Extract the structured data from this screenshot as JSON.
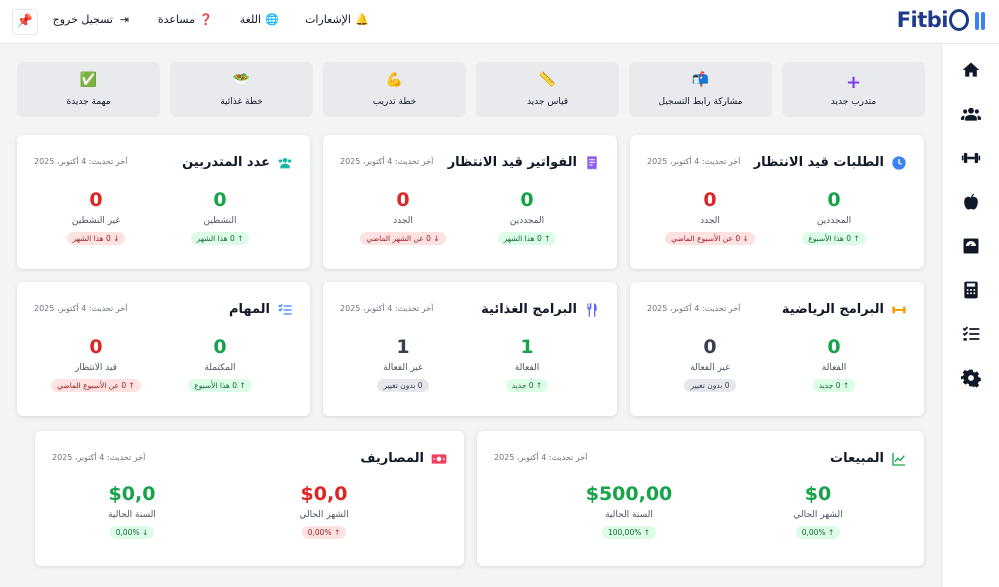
{
  "brand": {
    "logo_text": "Fitbi"
  },
  "topbar": {
    "notifications": "الإشعارات",
    "language": "اللغة",
    "help": "مساعدة",
    "logout": "تسجيل خروج"
  },
  "sidebar": {
    "items": [
      "home-icon",
      "users-icon",
      "dumbbell-icon",
      "apple-icon",
      "scale-icon",
      "calculator-icon",
      "checklist-icon",
      "gear-icon"
    ]
  },
  "quick_actions": [
    {
      "label": "متدرب جديد",
      "icon": "plus-icon"
    },
    {
      "label": "مشاركة رابط التسجيل",
      "icon": "mailbox-icon"
    },
    {
      "label": "قياس جديد",
      "icon": "ruler-icon"
    },
    {
      "label": "خطة تدريب",
      "icon": "flexed-biceps-icon"
    },
    {
      "label": "خطة غذائية",
      "icon": "salad-icon"
    },
    {
      "label": "مهمة جديدة",
      "icon": "check-box-icon"
    }
  ],
  "cards": {
    "pending_requests": {
      "title": "الطلبات قيد الانتظار",
      "updated": "آخر تحديث: 4 أكتوبر، 2025",
      "stat1": {
        "value": "0",
        "label": "المجددين",
        "badge": "0 هذا الأسبوع"
      },
      "stat2": {
        "value": "0",
        "label": "الجدد",
        "badge": "0 عن الأسبوع الماضي"
      }
    },
    "pending_invoices": {
      "title": "الفواتير قيد الانتظار",
      "updated": "آخر تحديث: 4 أكتوبر، 2025",
      "stat1": {
        "value": "0",
        "label": "المجددين",
        "badge": "0 هذا الشهر"
      },
      "stat2": {
        "value": "0",
        "label": "الجدد",
        "badge": "0 عن الشهر الماضي"
      }
    },
    "trainees": {
      "title": "عدد المتدربين",
      "updated": "آخر تحديث: 4 أكتوبر، 2025",
      "stat1": {
        "value": "0",
        "label": "النشطين",
        "badge": "0 هذا الشهر"
      },
      "stat2": {
        "value": "0",
        "label": "غير النشطين",
        "badge": "0 هذا الشهر"
      }
    },
    "workout_programs": {
      "title": "البرامج الرياضية",
      "updated": "آخر تحديث: 4 أكتوبر، 2025",
      "stat1": {
        "value": "0",
        "label": "الفعالة",
        "badge": "0 جديد"
      },
      "stat2": {
        "value": "0",
        "label": "غير الفعالة",
        "badge": "0 بدون تغيير"
      }
    },
    "diet_programs": {
      "title": "البرامج الغذائية",
      "updated": "آخر تحديث: 4 أكتوبر، 2025",
      "stat1": {
        "value": "1",
        "label": "الفعالة",
        "badge": "0 جديد"
      },
      "stat2": {
        "value": "1",
        "label": "غير الفعالة",
        "badge": "0 بدون تغيير"
      }
    },
    "tasks": {
      "title": "المهام",
      "updated": "آخر تحديث: 4 أكتوبر، 2025",
      "stat1": {
        "value": "0",
        "label": "المكتملة",
        "badge": "0 هذا الأسبوع"
      },
      "stat2": {
        "value": "0",
        "label": "قيد الانتظار",
        "badge": "0 عن الأسبوع الماضي"
      }
    },
    "sales": {
      "title": "المبيعات",
      "updated": "آخر تحديث: 4 أكتوبر، 2025",
      "stat1": {
        "value": "$0",
        "label": "الشهر الحالي",
        "badge": "0,00%"
      },
      "stat2": {
        "value": "$500,00",
        "label": "السنة الحالية",
        "badge": "100,00%"
      }
    },
    "expenses": {
      "title": "المصاريف",
      "updated": "آخر تحديث: 4 أكتوبر، 2025",
      "stat1": {
        "value": "$0,0",
        "label": "الشهر الحالي",
        "badge": "0,00%"
      },
      "stat2": {
        "value": "$0,0",
        "label": "السنة الحالية",
        "badge": "0,00%"
      }
    }
  },
  "colors": {
    "brand": "#1e3a8a",
    "accent_blue": "#3b82f6",
    "positive": "#16a34a",
    "negative": "#dc2626",
    "neutral": "#374151"
  }
}
